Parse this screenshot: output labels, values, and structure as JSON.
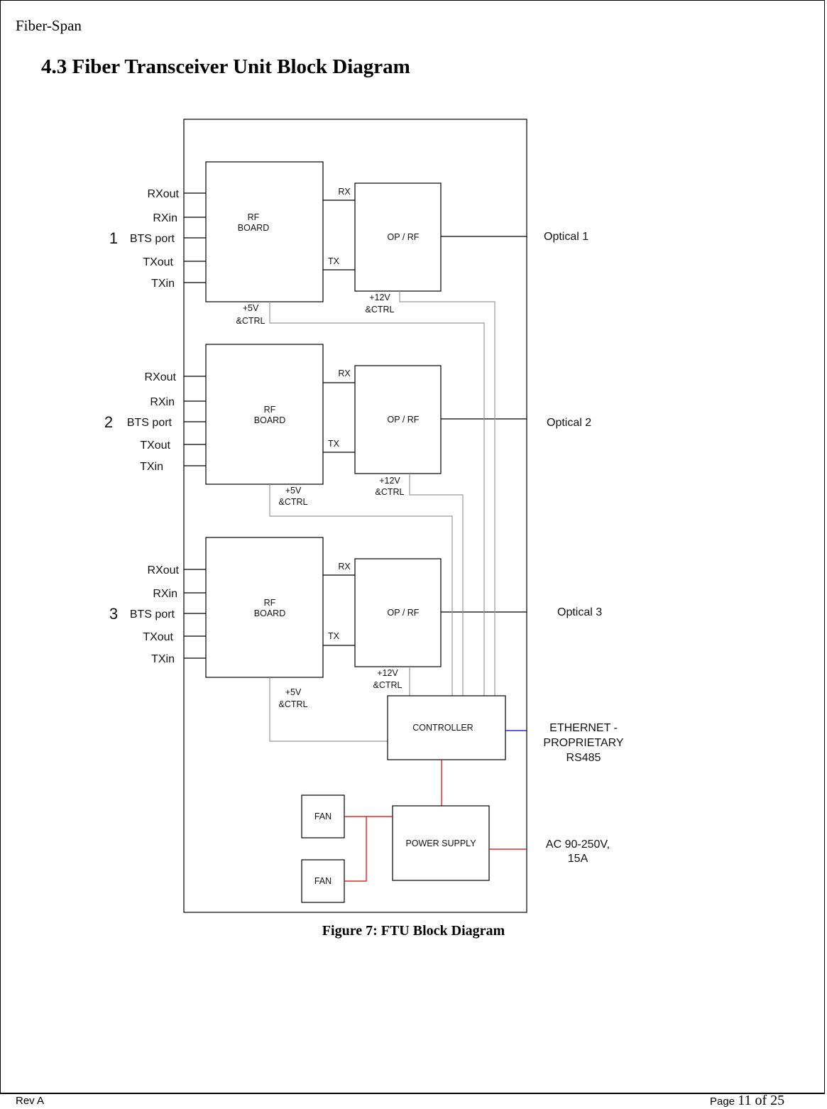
{
  "document": {
    "header": "Fiber-Span",
    "section_title": "4.3 Fiber Transceiver Unit Block Diagram",
    "figure_caption": "Figure 7: FTU Block Diagram",
    "footer_left": "Rev A",
    "footer_page_prefix": "Page ",
    "footer_page_number": "11 of 25"
  },
  "diagram": {
    "channels": [
      {
        "number": "1",
        "ports": [
          "RXout",
          "RXin",
          "BTS port",
          "TXout",
          "TXin"
        ],
        "rf_board": [
          "RF",
          "BOARD"
        ],
        "op_rf": "OP / RF",
        "rx": "RX",
        "tx": "TX",
        "rf_power": [
          "+5V",
          "&CTRL"
        ],
        "op_power": [
          "+12V",
          "&CTRL"
        ],
        "optical": "Optical 1"
      },
      {
        "number": "2",
        "ports": [
          "RXout",
          "RXin",
          "BTS port",
          "TXout",
          "TXin"
        ],
        "rf_board": [
          "RF",
          "BOARD"
        ],
        "op_rf": "OP / RF",
        "rx": "RX",
        "tx": "TX",
        "rf_power": [
          "+5V",
          "&CTRL"
        ],
        "op_power": [
          "+12V",
          "&CTRL"
        ],
        "optical": "Optical 2"
      },
      {
        "number": "3",
        "ports": [
          "RXout",
          "RXin",
          "BTS port",
          "TXout",
          "TXin"
        ],
        "rf_board": [
          "RF",
          "BOARD"
        ],
        "op_rf": "OP / RF",
        "rx": "RX",
        "tx": "TX",
        "rf_power": [
          "+5V",
          "&CTRL"
        ],
        "op_power": [
          "+12V",
          "&CTRL"
        ],
        "optical": "Optical 3"
      }
    ],
    "controller": "CONTROLLER",
    "power_supply": "POWER SUPPLY",
    "fans": [
      "FAN",
      "FAN"
    ],
    "ethernet_label": [
      "ETHERNET  -",
      "PROPRIETARY",
      "RS485"
    ],
    "ac_label": [
      "AC 90-250V,",
      "15A"
    ],
    "colors": {
      "outline": "#000000",
      "control_wire": "#999999",
      "power_wire": "#dd0000",
      "data_wire": "#0000cc"
    }
  }
}
